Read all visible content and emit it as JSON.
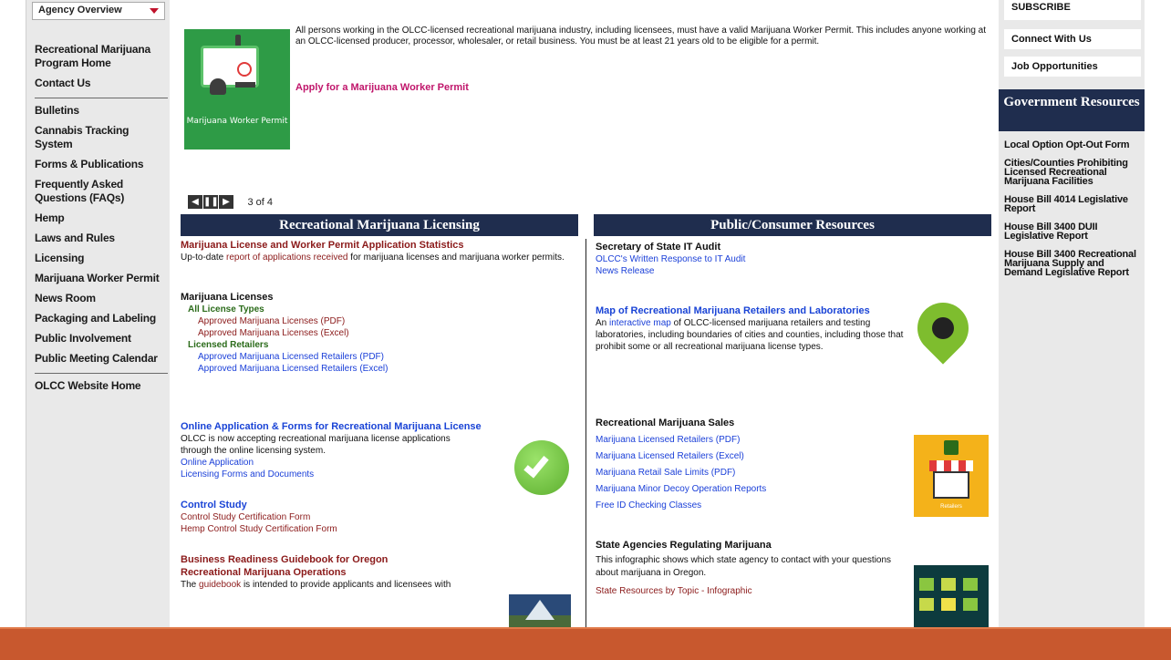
{
  "left_nav": {
    "agency_select": "Agency Overview",
    "items": [
      "Recreational Marijuana Program Home",
      "Contact Us",
      "Bulletins",
      "Cannabis Tracking System",
      "Forms & Publications",
      "Frequently Asked Questions (FAQs)",
      "Hemp",
      "Laws and Rules",
      "Licensing",
      "Marijuana Worker Permit",
      "News Room",
      "Packaging and Labeling",
      "Public Involvement",
      "Public Meeting Calendar",
      "OLCC Website Home"
    ]
  },
  "slide": {
    "badge_text": "Marijuana Worker Permit",
    "text": "All persons working in the OLCC-licensed recreational marijuana industry, including licensees, must have a valid Marijuana Worker Permit. This includes anyone working at an OLCC-licensed producer, processor, wholesaler, or retail business. You must be at least 21 years old to be eligible for a permit.",
    "link": "Apply for a Marijuana Worker Permit",
    "prev": "◀",
    "pause": "❚❚",
    "next": "▶",
    "counter": "3 of 4"
  },
  "licensing": {
    "title": "Recreational Marijuana Licensing",
    "stats_heading": "Marijuana License and Worker Permit Application Statistics",
    "stats_pre": "Up-to-date ",
    "stats_link": "report of applications received",
    "stats_post": " for marijuana licenses and marijuana worker permits.",
    "licenses_heading": "Marijuana Licenses",
    "all_types": "All License Types",
    "approved_pdf": "Approved Marijuana Licenses (PDF)",
    "approved_xls": "Approved Marijuana Licenses (Excel)",
    "licensed_retailers": "Licensed Retailers",
    "retailers_pdf": "Approved Marijuana Licensed Retailers (PDF)",
    "retailers_xls": "Approved Marijuana Licensed Retailers (Excel)",
    "online_heading": "Online Application & Forms for Recreational Marijuana License",
    "online_text": "OLCC is now accepting recreational marijuana license applications through the online licensing system.",
    "online_app": "Online Application",
    "forms_docs": "Licensing Forms and Documents",
    "control_heading": "Control Study",
    "control_form": "Control Study Certification Form",
    "hemp_control_form": "Hemp Control Study Certification Form",
    "guide_heading_1": "Business Readiness Guidebook for Oregon",
    "guide_heading_2": "Recreational Marijuana Operations",
    "guide_pre": "The ",
    "guide_link": "guidebook",
    "guide_post": " is intended to provide applicants and licensees with"
  },
  "public": {
    "title": "Public/Consumer Resources",
    "audit_heading": "Secretary of State IT Audit",
    "audit_response": "OLCC's Written Response to IT Audit",
    "news_release": "News Release",
    "map_heading": "Map of Recreational Marijuana Retailers and Laboratories",
    "map_pre": "An ",
    "map_link": "interactive map",
    "map_post": " of OLCC-licensed marijuana retailers and testing laboratories,  including boundaries of cities and counties, including those that prohibit some or all recreational marijuana license types.",
    "sales_heading": "Recreational Marijuana Sales",
    "sales_links": [
      "Marijuana Licensed Retailers (PDF)",
      "Marijuana Licensed Retailers (Excel)",
      "Marijuana Retail Sale Limits (PDF)",
      "Marijuana Minor Decoy Operation Reports",
      "Free ID Checking Classes"
    ],
    "store_label": "Retailers",
    "agencies_heading": "State Agencies Regulating Marijuana",
    "agencies_text": "This infographic shows which state agency to contact with your questions about marijuana in Oregon.",
    "agencies_link": "State Resources by Topic - Infographic"
  },
  "right": {
    "subscribe": "SUBSCRIBE",
    "connect": "Connect With Us",
    "jobs": "Job Opportunities",
    "gov_heading": "Government Resources",
    "gov_items": [
      "Local Option Opt-Out Form",
      "Cities/Counties Prohibiting Licensed Recreational Marijuana Facilities",
      "House Bill 4014 Legislative Report",
      "House Bill 3400 DUII Legislative Report",
      "House Bill 3400 Recreational Marijuana Supply and Demand Legislative Report"
    ]
  },
  "colors": {
    "header_navy": "#1f2d4e",
    "bottom_bar": "#c8582e",
    "link_blue": "#1a3fd8",
    "link_dark_red": "#8b1a1a",
    "permit_link": "#c0166b",
    "badge_green": "#2e9b46"
  }
}
